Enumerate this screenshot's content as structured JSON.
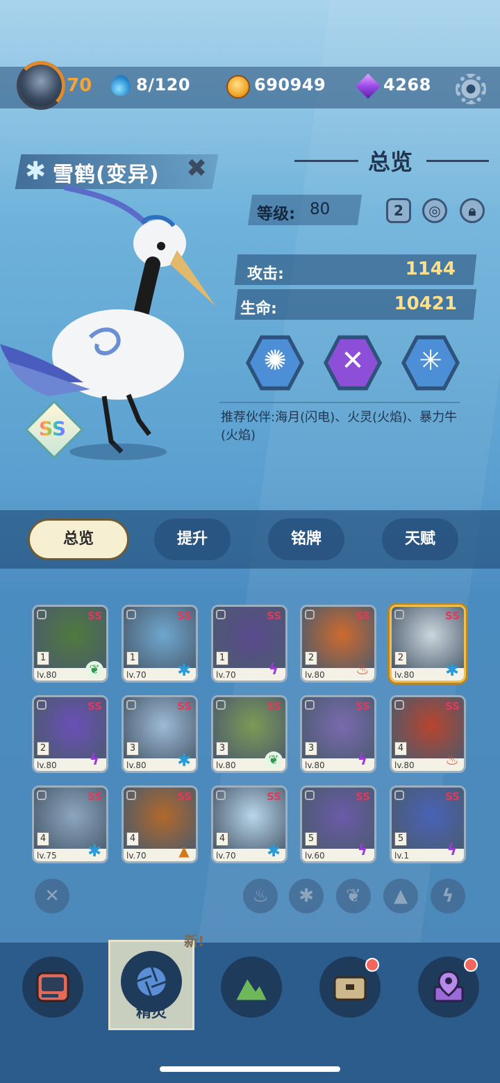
{
  "topbar": {
    "player_level": "70",
    "energy": "8/120",
    "coins": "690949",
    "gems": "4268",
    "icons": [
      "avatar",
      "water-drop-icon",
      "coin-icon",
      "gem-icon",
      "gear-icon"
    ]
  },
  "pet": {
    "name": "雪鹤(变异)",
    "element_icon": "snowflake-icon",
    "rarity": "SS"
  },
  "overview": {
    "title": "总览",
    "level_label": "等级:",
    "level_value": "80",
    "level_buttons": [
      "2"
    ],
    "attack_label": "攻击:",
    "attack_value": "1144",
    "hp_label": "生命:",
    "hp_value": "10421",
    "skills": [
      "vortex-skill-icon",
      "cross-slash-skill-icon",
      "star-cross-skill-icon"
    ],
    "recommend": "推荐伙伴:海月(闪电)、火灵(火焰)、暴力牛(火焰)"
  },
  "tabs": [
    "总览",
    "提升",
    "铭牌",
    "天赋"
  ],
  "cards": [
    {
      "star": "1",
      "lv": "lv.80",
      "rarity": "SS",
      "element": "leaf",
      "art": "#4f7a3e"
    },
    {
      "star": "1",
      "lv": "lv.70",
      "rarity": "SS",
      "element": "ice",
      "art": "#6fa7cf"
    },
    {
      "star": "1",
      "lv": "lv.70",
      "rarity": "SS",
      "element": "bolt",
      "art": "#5b4a8f"
    },
    {
      "star": "2",
      "lv": "lv.80",
      "rarity": "SS",
      "element": "fire",
      "art": "#cf6a2e"
    },
    {
      "star": "2",
      "lv": "lv.80",
      "rarity": "SS",
      "element": "ice",
      "art": "#cdd6dd"
    },
    {
      "star": "2",
      "lv": "lv.80",
      "rarity": "SS",
      "element": "bolt",
      "art": "#6b4fb8"
    },
    {
      "star": "3",
      "lv": "lv.80",
      "rarity": "SS",
      "element": "ice",
      "art": "#9dbbd6"
    },
    {
      "star": "3",
      "lv": "lv.80",
      "rarity": "SS",
      "element": "leaf",
      "art": "#7e9a55"
    },
    {
      "star": "3",
      "lv": "lv.80",
      "rarity": "SS",
      "element": "bolt",
      "art": "#7a6ab0"
    },
    {
      "star": "4",
      "lv": "lv.80",
      "rarity": "SS",
      "element": "fire",
      "art": "#b8442e"
    },
    {
      "star": "4",
      "lv": "lv.75",
      "rarity": "SS",
      "element": "ice",
      "art": "#8ca6bf"
    },
    {
      "star": "4",
      "lv": "lv.70",
      "rarity": "SS",
      "element": "rock",
      "art": "#b2682a"
    },
    {
      "star": "4",
      "lv": "lv.70",
      "rarity": "SS",
      "element": "ice",
      "art": "#b9d6ea"
    },
    {
      "star": "5",
      "lv": "lv.60",
      "rarity": "SS",
      "element": "bolt",
      "art": "#6a5aa8"
    },
    {
      "star": "5",
      "lv": "lv.1",
      "rarity": "SS",
      "element": "bolt",
      "art": "#4a62b8"
    }
  ],
  "filters": [
    "clear-filter",
    "fire-filter",
    "ice-filter",
    "leaf-filter",
    "rock-filter",
    "bolt-filter"
  ],
  "nav": {
    "active_label": "精灵",
    "new_badge": "新!"
  }
}
